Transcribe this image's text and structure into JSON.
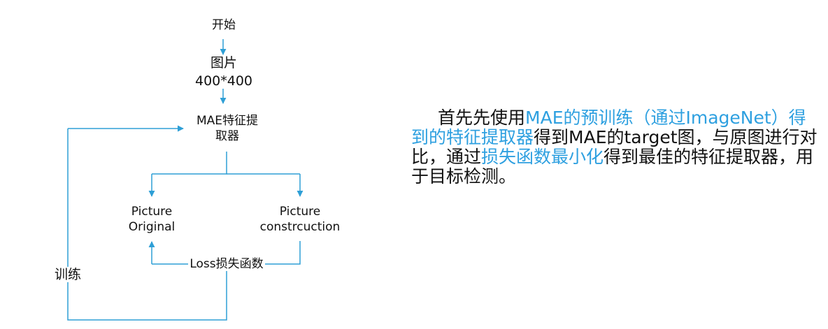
{
  "flowchart": {
    "start": "开始",
    "picture": {
      "line1": "图片",
      "line2": "400*400"
    },
    "extractor": {
      "line1": "MAE特征提",
      "line2": "取器"
    },
    "original": {
      "line1": "Picture",
      "line2": "Original"
    },
    "reconstruction": {
      "line1": "Picture",
      "line2": "constrcuction"
    },
    "loss": "Loss损失函数",
    "train": "训练",
    "line_color": "#2e9fd6"
  },
  "description": {
    "segments": [
      {
        "text": "首先先使用",
        "highlight": false
      },
      {
        "text": "MAE的预训练（通过ImageNet）得到的特征提取器",
        "highlight": true
      },
      {
        "text": "得到MAE的target图，与原图进行对比，通过",
        "highlight": false
      },
      {
        "text": "损失函数最小化",
        "highlight": true
      },
      {
        "text": "得到最佳的特征提取器，用于目标检测。",
        "highlight": false
      }
    ],
    "highlight_color": "#2ea0e0"
  }
}
